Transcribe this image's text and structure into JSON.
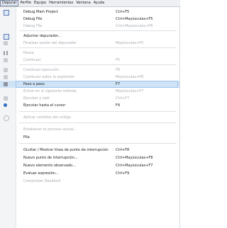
{
  "menubar": {
    "items": [
      "Depurar",
      "Perfile",
      "Equipo",
      "Herramientas",
      "Ventana",
      "Ayuda"
    ]
  },
  "menu": {
    "items": [
      {
        "label": "Debug Main Project",
        "shortcut": "Ctrl+F5",
        "icon": "debug-project-icon",
        "disabled": false
      },
      {
        "label": "Debug File",
        "shortcut": "Ctrl+Mayúsculas+F5",
        "icon": "",
        "disabled": false
      },
      {
        "label": "Debug File",
        "shortcut": "Ctrl+Mayúsculas+F6",
        "icon": "",
        "disabled": true
      },
      {
        "label": "Adjuntar depurador...",
        "shortcut": "",
        "icon": "attach-debugger-icon",
        "disabled": false
      },
      {
        "label": "Finalizar sesión del depurador",
        "shortcut": "Mayúsculas+F5",
        "icon": "stop-session-icon",
        "disabled": true
      },
      {
        "label": "Pausa",
        "shortcut": "",
        "icon": "pause-icon",
        "disabled": true
      },
      {
        "label": "Continuar",
        "shortcut": "F5",
        "icon": "continue-icon",
        "disabled": true
      },
      {
        "label": "Continuar ejecución",
        "shortcut": "F8",
        "icon": "step-over-icon",
        "disabled": true
      },
      {
        "label": "Continuar sobre la expresión",
        "shortcut": "Mayúsculas+F8",
        "icon": "step-over-expression-icon",
        "disabled": true
      },
      {
        "label": "Paso a paso",
        "shortcut": "F7",
        "icon": "step-into-icon",
        "disabled": false,
        "highlighted": true
      },
      {
        "label": "Entrar en el siguiente método",
        "shortcut": "Mayúsculas+F7",
        "icon": "",
        "disabled": true
      },
      {
        "label": "Ejecutar y salir",
        "shortcut": "Ctrl+F7",
        "icon": "step-out-icon",
        "disabled": true
      },
      {
        "label": "Ejecutar hasta el cursor",
        "shortcut": "F4",
        "icon": "run-to-cursor-icon",
        "disabled": false
      },
      {
        "label": "Aplicar cambios del código",
        "shortcut": "",
        "icon": "apply-changes-icon",
        "disabled": true
      },
      {
        "label": "Establecer el proceso actual...",
        "shortcut": "",
        "icon": "",
        "disabled": true
      },
      {
        "label": "Pila",
        "shortcut": "",
        "icon": "",
        "disabled": false
      },
      {
        "label": "Ocultar / Mostrar línea de punto de interrupción",
        "shortcut": "Ctrl+F8",
        "icon": "",
        "disabled": false
      },
      {
        "label": "Nuevo punto de interrupción...",
        "shortcut": "Ctrl+Mayúsculas+F8",
        "icon": "",
        "disabled": false
      },
      {
        "label": "Nuevo elemento observado...",
        "shortcut": "Ctrl+Mayúsculas+F7",
        "icon": "",
        "disabled": false
      },
      {
        "label": "Evaluar expresión...",
        "shortcut": "Ctrl+F9",
        "icon": "",
        "disabled": false
      },
      {
        "label": "Comprobar Deadlock",
        "shortcut": "",
        "icon": "",
        "disabled": true
      }
    ]
  }
}
